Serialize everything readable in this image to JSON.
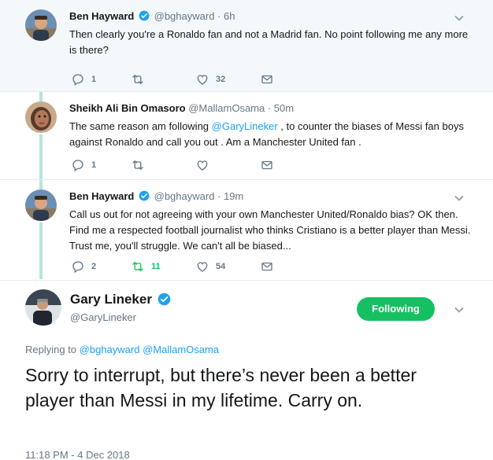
{
  "thread": [
    {
      "name": "Ben Hayward",
      "handle": "@bghayward · 6h",
      "text": "Then clearly you're a Ronaldo fan and not a Madrid fan. No point following me any more is there?",
      "reply_count": "1",
      "retweet_count": "",
      "like_count": "32"
    },
    {
      "name": "Sheikh Ali Bin Omasoro",
      "handle": "@MallamOsama · 50m",
      "text_before": "The same reason am following ",
      "text_mention": "@GaryLineker",
      "text_after": " , to counter the biases of Messi fan boys against Ronaldo and call you out . Am a Manchester United fan .",
      "reply_count": "1",
      "retweet_count": "",
      "like_count": ""
    },
    {
      "name": "Ben Hayward",
      "handle": "@bghayward · 19m",
      "text": "Call us out for not agreeing with your own Manchester United/Ronaldo bias? OK then. Find me a respected football journalist who thinks Cristiano is a better player than Messi. Trust me, you'll struggle. We can't all be biased...",
      "reply_count": "2",
      "retweet_count": "11",
      "like_count": "54"
    }
  ],
  "main_tweet": {
    "name": "Gary Lineker",
    "handle": "@GaryLineker",
    "follow_label": "Following",
    "replying_label": "Replying to",
    "replying_mention_1": "@bghayward",
    "replying_mention_2": "@MallamOsama",
    "text": "Sorry to interrupt, but there’s never been a better player than Messi in my lifetime. Carry on.",
    "timestamp": "11:18 PM - 4 Dec 2018"
  },
  "colors": {
    "accent": "#1da1f2",
    "retweet_active": "#17bf63",
    "follow_button": "#17bf63",
    "thread_line": "#b3e7d9"
  },
  "icons": [
    "reply-icon",
    "retweet-icon",
    "like-icon",
    "message-icon",
    "verified-icon",
    "chevron-down-icon"
  ]
}
